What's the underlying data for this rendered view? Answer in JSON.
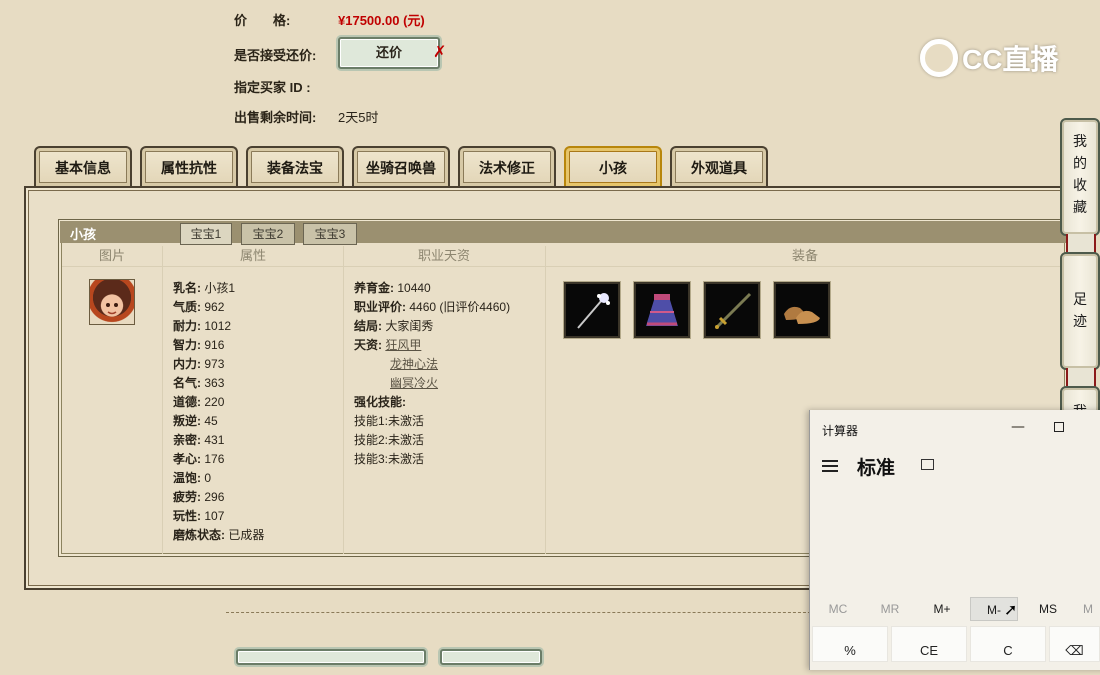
{
  "header": {
    "price_label": "价　　格:",
    "price_value": "¥17500.00 (元)",
    "counter_offer_label": "是否接受还价:",
    "counter_offer_button": "还价",
    "buyer_id_label": "指定买家 ID :",
    "time_left_label": "出售剩余时间:",
    "time_left_value": "2天5时"
  },
  "watermark": {
    "text": "CC直播"
  },
  "tabs": [
    {
      "label": "基本信息",
      "active": false
    },
    {
      "label": "属性抗性",
      "active": false
    },
    {
      "label": "装备法宝",
      "active": false
    },
    {
      "label": "坐骑召唤兽",
      "active": false
    },
    {
      "label": "法术修正",
      "active": false
    },
    {
      "label": "小孩",
      "active": true
    },
    {
      "label": "外观道具",
      "active": false
    }
  ],
  "panel": {
    "title": "小孩",
    "subtabs": [
      "宝宝1",
      "宝宝2",
      "宝宝3"
    ],
    "columns": [
      "图片",
      "属性",
      "职业天资",
      "装备"
    ],
    "attributes": [
      {
        "k": "乳名:",
        "v": "小孩1"
      },
      {
        "k": "气质:",
        "v": "962"
      },
      {
        "k": "耐力:",
        "v": "1012"
      },
      {
        "k": "智力:",
        "v": "916"
      },
      {
        "k": "内力:",
        "v": "973"
      },
      {
        "k": "名气:",
        "v": "363"
      },
      {
        "k": "道德:",
        "v": "220"
      },
      {
        "k": "叛逆:",
        "v": "45"
      },
      {
        "k": "亲密:",
        "v": "431"
      },
      {
        "k": "孝心:",
        "v": "176"
      },
      {
        "k": "温饱:",
        "v": "0"
      },
      {
        "k": "疲劳:",
        "v": "296"
      },
      {
        "k": "玩性:",
        "v": "107"
      },
      {
        "k": "磨炼状态:",
        "v": "已成器"
      }
    ],
    "career": {
      "upbringing_label": "养育金:",
      "upbringing_value": "10440",
      "rating_label": "职业评价:",
      "rating_value": "4460 (旧评价4460)",
      "ending_label": "结局:",
      "ending_value": "大家闺秀",
      "talent_label": "天资:",
      "talents": [
        "狂风甲",
        "龙神心法",
        "幽冥冷火"
      ],
      "skills_title": "强化技能:",
      "skills": [
        {
          "k": "技能1:",
          "v": "未激活"
        },
        {
          "k": "技能2:",
          "v": "未激活"
        },
        {
          "k": "技能3:",
          "v": "未激活"
        }
      ]
    },
    "equipment_icons": [
      "hairpin-icon",
      "skirt-icon",
      "sword-icon",
      "shoes-icon"
    ]
  },
  "side_buttons": [
    {
      "label": "我的收藏"
    },
    {
      "label": "足迹"
    },
    {
      "label": "我"
    }
  ],
  "calculator": {
    "window_title": "计算器",
    "mode": "标准",
    "memory": [
      "MC",
      "MR",
      "M+",
      "M-",
      "MS",
      "M"
    ],
    "keys": [
      "%",
      "CE",
      "C",
      "⌫"
    ],
    "colors": {
      "bg": "#f3f0e8"
    }
  }
}
